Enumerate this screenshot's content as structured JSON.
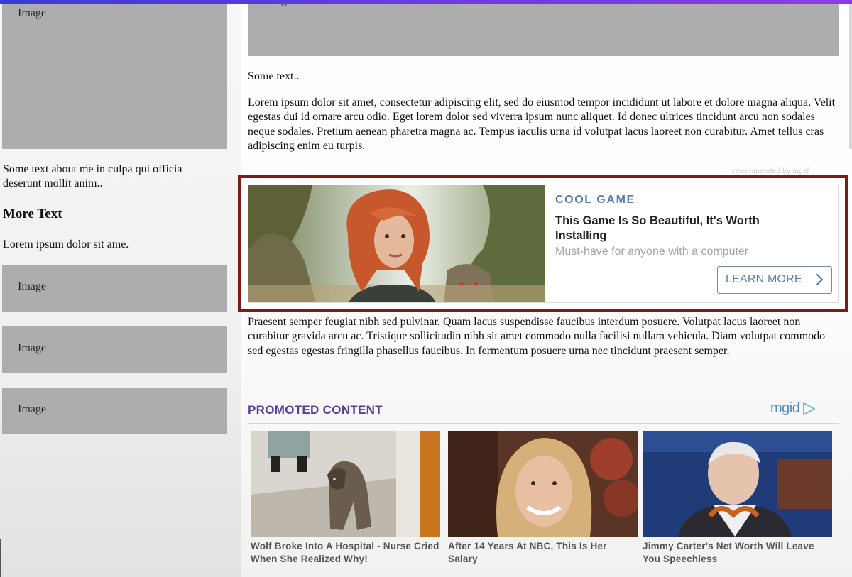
{
  "sidebar": {
    "placeholders": [
      "Image",
      "Image",
      "Image",
      "Image"
    ],
    "about_text": "Some text about me in culpa qui officia deserunt mollit anim..",
    "more_heading": "More Text",
    "more_text": "Lorem ipsum dolor sit ame."
  },
  "main": {
    "hero_placeholder": "Image",
    "some_text": "Some text..",
    "paragraph1": "Lorem ipsum dolor sit amet, consectetur adipiscing elit, sed do eiusmod tempor incididunt ut labore et dolore magna aliqua. Velit egestas dui id ornare arcu odio. Eget lorem dolor sed viverra ipsum nunc aliquet. Id donec ultrices tincidunt arcu non sodales neque sodales. Pretium aenean pharetra magna ac. Tempus iaculis urna id volutpat lacus laoreet non curabitur. Amet tellus cras adipiscing enim eu turpis.",
    "recommended": "recommended by mgid",
    "paragraph2": "Praesent semper feugiat nibh sed pulvinar. Quam lacus suspendisse faucibus interdum posuere. Volutpat lacus laoreet non curabitur gravida arcu ac. Tristique sollicitudin nibh sit amet commodo nulla facilisi nullam vehicula. Diam volutpat commodo sed egestas egestas fringilla phasellus faucibus. In fermentum posuere urna nec tincidunt praesent semper."
  },
  "ad": {
    "category": "COOL GAME",
    "title": "This Game Is So Beautiful, It's Worth Installing",
    "description": "Must-have for anyone with a computer",
    "button_label": "LEARN MORE",
    "image_icon": "game-character-image",
    "accent_color": "#5a7fa8",
    "highlight_color": "#7b1d16"
  },
  "promoted": {
    "heading": "PROMOTED CONTENT",
    "logo": "mgid",
    "cards": [
      {
        "caption": "Wolf Broke Into A Hospital - Nurse Cried When She Realized Why!",
        "image": "wolf-hospital-image"
      },
      {
        "caption": "After 14 Years At NBC, This Is Her Salary",
        "image": "smiling-woman-image"
      },
      {
        "caption": "Jimmy Carter's Net Worth Will Leave You Speechless",
        "image": "elderly-man-image"
      }
    ]
  }
}
